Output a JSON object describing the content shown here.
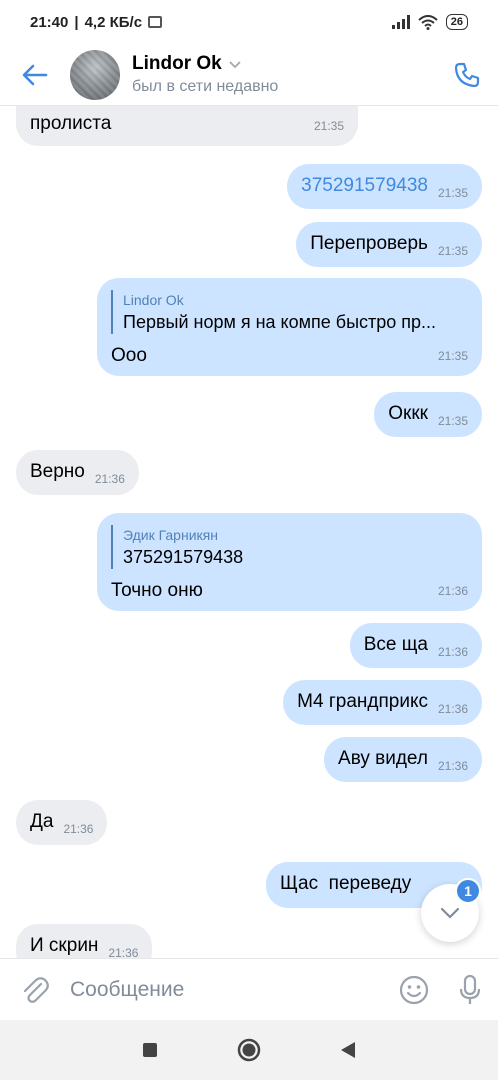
{
  "status_bar": {
    "time": "21:40",
    "speed": "4,2 КБ/с",
    "battery": "26"
  },
  "header": {
    "title": "Lindor Ok",
    "subtitle": "был в сети недавно"
  },
  "messages": [
    {
      "dir": "in",
      "text": "пролиста",
      "time": "21:35"
    },
    {
      "dir": "out",
      "text": "375291579438",
      "time": "21:35",
      "is_link": true
    },
    {
      "dir": "out",
      "text": "Перепроверь",
      "time": "21:35"
    },
    {
      "dir": "out",
      "reply_author": "Lindor Ok",
      "reply_text": "Первый норм я на компе быстро пр...",
      "text": "Ооо",
      "time": "21:35"
    },
    {
      "dir": "out",
      "text": "Оккк",
      "time": "21:35"
    },
    {
      "dir": "in",
      "text": "Верно",
      "time": "21:36"
    },
    {
      "dir": "out",
      "reply_author": "Эдик Гарникян",
      "reply_text": "375291579438",
      "text": "Точно оню",
      "time": "21:36"
    },
    {
      "dir": "out",
      "text": "Все ща",
      "time": "21:36"
    },
    {
      "dir": "out",
      "text": "М4 грандприкс",
      "time": "21:36"
    },
    {
      "dir": "out",
      "text": "Аву видел",
      "time": "21:36"
    },
    {
      "dir": "in",
      "text": "Да",
      "time": "21:36"
    },
    {
      "dir": "out",
      "text": "Щас  переведу",
      "time": ""
    },
    {
      "dir": "in",
      "text": "И скрин",
      "time": "21:36"
    }
  ],
  "scroll_badge": "1",
  "composer": {
    "placeholder": "Сообщение"
  },
  "colors": {
    "accent": "#3f8ae0",
    "incoming_bubble": "#ebedf0",
    "outgoing_bubble": "#cce4ff",
    "muted": "#818c99"
  },
  "icons": {
    "back": "arrow-left-icon",
    "call": "phone-icon",
    "attach": "paperclip-icon",
    "emoji": "smiley-icon",
    "mic": "microphone-icon",
    "scroll": "chevron-down-icon",
    "nav": [
      "square-icon",
      "circle-icon",
      "triangle-back-icon"
    ]
  }
}
